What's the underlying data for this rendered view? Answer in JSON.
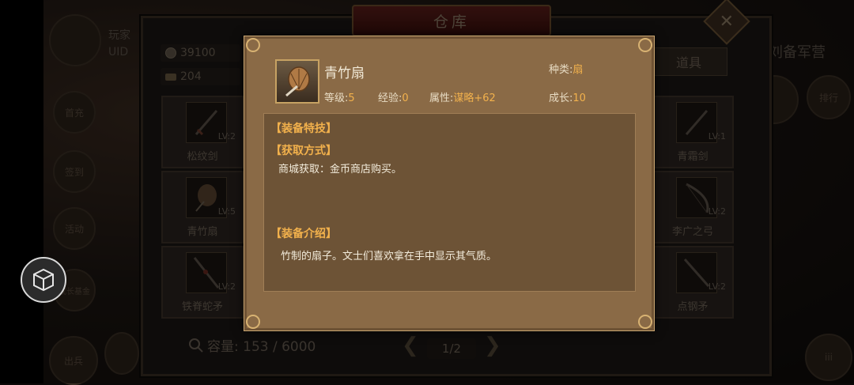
{
  "warehouse": {
    "title": "仓库",
    "coins": "39100",
    "ingots": "204",
    "tab": "道具",
    "capacity_label": "容量: 153 / 6000",
    "page": "1/2",
    "slots_left": [
      {
        "name": "松纹剑",
        "level": "LV:2"
      },
      {
        "name": "青竹扇",
        "level": "LV:5"
      },
      {
        "name": "铁脊蛇矛",
        "level": "LV:2"
      }
    ],
    "slots_right": [
      {
        "name": "青霜剑",
        "level": "LV:1"
      },
      {
        "name": "李广之弓",
        "level": "LV:2"
      },
      {
        "name": "点钢矛",
        "level": "LV:2"
      }
    ]
  },
  "background": {
    "player_label": "玩家",
    "uid_label": "UID",
    "camp_label": "刘备军营",
    "left_menu": [
      "首充",
      "签到",
      "活动",
      "成长基金",
      "出兵"
    ],
    "right_menu": [
      "排行"
    ]
  },
  "item": {
    "name": "青竹扇",
    "type_label": "种类:",
    "type_value": "扇",
    "level_label": "等级:",
    "level_value": "5",
    "exp_label": "经验:",
    "exp_value": "0",
    "attr_label": "属性:",
    "attr_value": "谋略+62",
    "growth_label": "成长:",
    "growth_value": "10",
    "skill_title": "【装备特技】",
    "obtain_title": "【获取方式】",
    "obtain_text": "商城获取：金币商店购买。",
    "intro_title": "【装备介绍】",
    "intro_text": "竹制的扇子。文士们喜欢拿在手中显示其气质。"
  },
  "colors": {
    "popup_bg": "#8a6a46",
    "desc_bg": "#6d5336",
    "accent_orange": "#f2b14c",
    "title_red": "#5b1e1a"
  },
  "icons": [
    "fan-icon",
    "sword-icon",
    "bow-icon",
    "spear-icon",
    "coin-icon",
    "ingot-icon",
    "search-icon",
    "close-icon",
    "cube-menu-icon"
  ]
}
